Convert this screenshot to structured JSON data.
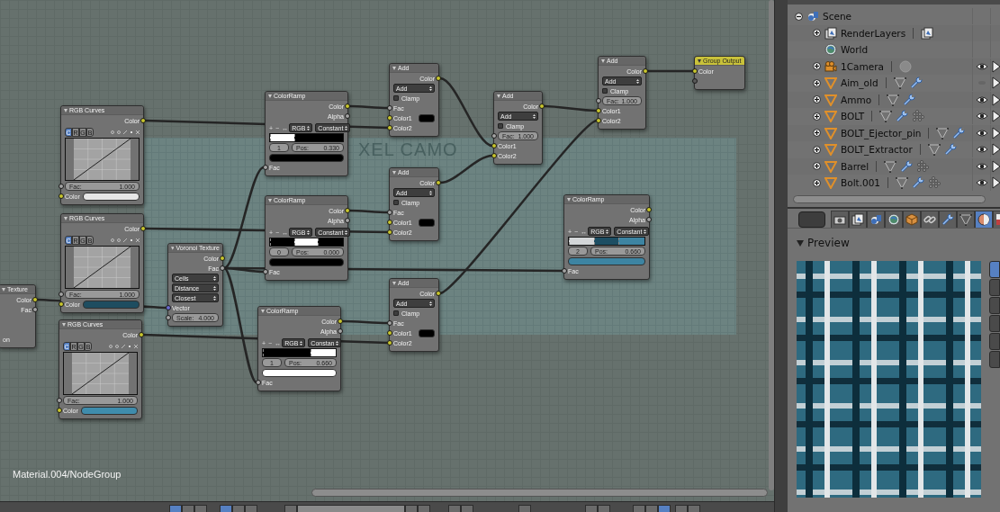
{
  "node_editor": {
    "frame": {
      "label": "XEL CAMO"
    },
    "nodes": [
      {
        "kind": "rgb_curves",
        "title": "RGB Curves",
        "rows": [
          {
            "kind": "output",
            "label": "Color",
            "socket": {
              "kind": "color"
            }
          },
          {
            "kind": "curve_tabs",
            "channels": [
              {
                "label": "C",
                "selected": true
              },
              {
                "label": "R",
                "selected": false
              },
              {
                "label": "G",
                "selected": false
              },
              {
                "label": "B",
                "selected": false
              }
            ]
          },
          {
            "kind": "curve"
          },
          {
            "kind": "field",
            "label": "Fac:",
            "value": "1.000",
            "socket": {
              "kind": "float"
            }
          },
          {
            "kind": "color_input",
            "label": "Color",
            "socket": {
              "kind": "color"
            },
            "color": "#e6e6e6"
          }
        ]
      },
      {
        "kind": "rgb_curves",
        "title": "RGB Curves",
        "rows": [
          {
            "kind": "output",
            "label": "Color",
            "socket": {
              "kind": "color"
            }
          },
          {
            "kind": "curve_tabs",
            "channels": [
              {
                "label": "C",
                "selected": true
              },
              {
                "label": "R",
                "selected": false
              },
              {
                "label": "G",
                "selected": false
              },
              {
                "label": "B",
                "selected": false
              }
            ]
          },
          {
            "kind": "curve"
          },
          {
            "kind": "field",
            "label": "Fac:",
            "value": "1.000",
            "socket": {
              "kind": "float"
            }
          },
          {
            "kind": "color_input",
            "label": "Color",
            "socket": {
              "kind": "color"
            },
            "color": "#1e4d60"
          }
        ]
      },
      {
        "kind": "rgb_curves",
        "title": "RGB Curves",
        "rows": [
          {
            "kind": "output",
            "label": "Color",
            "socket": {
              "kind": "color"
            }
          },
          {
            "kind": "curve_tabs",
            "channels": [
              {
                "label": "C",
                "selected": true
              },
              {
                "label": "R",
                "selected": false
              },
              {
                "label": "G",
                "selected": false
              },
              {
                "label": "B",
                "selected": false
              }
            ]
          },
          {
            "kind": "curve"
          },
          {
            "kind": "field",
            "label": "Fac:",
            "value": "1.000",
            "socket": {
              "kind": "float"
            }
          },
          {
            "kind": "color_input",
            "label": "Color",
            "socket": {
              "kind": "color"
            },
            "color": "#3f8cac"
          }
        ]
      },
      {
        "kind": "texture",
        "title": "Texture",
        "rows": [
          {
            "kind": "output",
            "label": "Color",
            "socket": {
              "kind": "color"
            }
          },
          {
            "kind": "output",
            "label": "Fac",
            "socket": {
              "kind": "float"
            }
          },
          {
            "kind": "spacer"
          },
          {
            "kind": "spacer"
          },
          {
            "kind": "input",
            "label": "on"
          }
        ]
      },
      {
        "kind": "voronoi",
        "title": "Voronoi Texture",
        "rows": [
          {
            "kind": "output",
            "label": "Color",
            "socket": {
              "kind": "color"
            }
          },
          {
            "kind": "output",
            "label": "Fac",
            "socket": {
              "kind": "float"
            }
          },
          {
            "kind": "dropdown",
            "value": "Cells"
          },
          {
            "kind": "dropdown",
            "value": "Distance"
          },
          {
            "kind": "dropdown",
            "value": "Closest"
          },
          {
            "kind": "input",
            "label": "Vector",
            "socket": {
              "kind": "vector"
            }
          },
          {
            "kind": "field",
            "label": "Scale:",
            "value": "4.000",
            "socket": {
              "kind": "float"
            }
          }
        ]
      },
      {
        "kind": "color_ramp",
        "title": "ColorRamp",
        "rows": [
          {
            "kind": "output",
            "label": "Color",
            "socket": {
              "kind": "color"
            }
          },
          {
            "kind": "output",
            "label": "Alpha",
            "socket": {
              "kind": "float"
            }
          },
          {
            "kind": "ramp_toolbar",
            "tools": [
              "+",
              "−",
              "↔"
            ],
            "mode": "RGB",
            "interp": "Constant"
          },
          {
            "kind": "ramp",
            "stops": [
              {
                "color": "#ffffff",
                "level": 0
              },
              {
                "color": "#000000",
                "level": 0.33
              }
            ]
          },
          {
            "kind": "ramp_stop",
            "index": "1",
            "label": "Pos:",
            "value": "0.330"
          },
          {
            "kind": "swatch",
            "color": "#000000"
          },
          {
            "kind": "input",
            "label": "Fac",
            "socket": {
              "kind": "float"
            }
          }
        ]
      },
      {
        "kind": "color_ramp",
        "title": "ColorRamp",
        "rows": [
          {
            "kind": "output",
            "label": "Color",
            "socket": {
              "kind": "color"
            }
          },
          {
            "kind": "output",
            "label": "Alpha",
            "socket": {
              "kind": "float"
            }
          },
          {
            "kind": "ramp_toolbar",
            "tools": [
              "+",
              "−",
              "↔"
            ],
            "mode": "RGB",
            "interp": "Constant"
          },
          {
            "kind": "ramp",
            "stops": [
              {
                "color": "#000000",
                "level": 0
              },
              {
                "color": "#ffffff",
                "level": 0.33
              },
              {
                "color": "#000000",
                "level": 0.65
              }
            ]
          },
          {
            "kind": "ramp_stop",
            "index": "0",
            "label": "Pos:",
            "value": "0.000"
          },
          {
            "kind": "swatch",
            "color": "#000000"
          },
          {
            "kind": "input",
            "label": "Fac",
            "socket": {
              "kind": "float"
            }
          }
        ]
      },
      {
        "kind": "color_ramp",
        "title": "ColorRamp",
        "rows": [
          {
            "kind": "output",
            "label": "Color",
            "socket": {
              "kind": "color"
            }
          },
          {
            "kind": "output",
            "label": "Alpha",
            "socket": {
              "kind": "float"
            }
          },
          {
            "kind": "ramp_toolbar",
            "tools": [
              "+",
              "−",
              "↔"
            ],
            "mode": "RGB",
            "interp": "Constan"
          },
          {
            "kind": "ramp",
            "stops": [
              {
                "color": "#000000",
                "level": 0
              },
              {
                "color": "#ffffff",
                "level": 0.66
              }
            ]
          },
          {
            "kind": "ramp_stop",
            "index": "1",
            "label": "Pos:",
            "value": "0.660"
          },
          {
            "kind": "swatch",
            "color": "#ffffff"
          },
          {
            "kind": "input",
            "label": "Fac",
            "socket": {
              "kind": "float"
            }
          }
        ]
      },
      {
        "kind": "mix",
        "title": "Add",
        "rows": [
          {
            "kind": "output",
            "label": "Color",
            "socket": {
              "kind": "color"
            }
          },
          {
            "kind": "dropdown",
            "value": "Add"
          },
          {
            "kind": "checkbox",
            "label": "Clamp",
            "checked": false
          },
          {
            "kind": "input",
            "label": "Fac",
            "socket": {
              "kind": "float"
            }
          },
          {
            "kind": "color_input",
            "label": "Color1",
            "socket": {
              "kind": "color"
            },
            "color": "#000000"
          },
          {
            "kind": "input",
            "label": "Color2",
            "socket": {
              "kind": "color"
            }
          }
        ]
      },
      {
        "kind": "mix",
        "title": "Add",
        "rows": [
          {
            "kind": "output",
            "label": "Color",
            "socket": {
              "kind": "color"
            }
          },
          {
            "kind": "dropdown",
            "value": "Add"
          },
          {
            "kind": "checkbox",
            "label": "Clamp",
            "checked": false
          },
          {
            "kind": "input",
            "label": "Fac",
            "socket": {
              "kind": "float"
            }
          },
          {
            "kind": "color_input",
            "label": "Color1",
            "socket": {
              "kind": "color"
            },
            "color": "#000000"
          },
          {
            "kind": "input",
            "label": "Color2",
            "socket": {
              "kind": "color"
            }
          }
        ]
      },
      {
        "kind": "mix",
        "title": "Add",
        "rows": [
          {
            "kind": "output",
            "label": "Color",
            "socket": {
              "kind": "color"
            }
          },
          {
            "kind": "dropdown",
            "value": "Add"
          },
          {
            "kind": "checkbox",
            "label": "Clamp",
            "checked": false
          },
          {
            "kind": "input",
            "label": "Fac",
            "socket": {
              "kind": "float"
            }
          },
          {
            "kind": "color_input",
            "label": "Color1",
            "socket": {
              "kind": "color"
            },
            "color": "#000000"
          },
          {
            "kind": "input",
            "label": "Color2",
            "socket": {
              "kind": "color"
            }
          }
        ]
      },
      {
        "kind": "mix",
        "title": "Add",
        "rows": [
          {
            "kind": "output",
            "label": "Color",
            "socket": {
              "kind": "color"
            }
          },
          {
            "kind": "dropdown",
            "value": "Add"
          },
          {
            "kind": "checkbox",
            "label": "Clamp",
            "checked": false
          },
          {
            "kind": "field",
            "label": "Fac:",
            "value": "1.000",
            "socket": {
              "kind": "float"
            }
          },
          {
            "kind": "input",
            "label": "Color1",
            "socket": {
              "kind": "color"
            }
          },
          {
            "kind": "input",
            "label": "Color2",
            "socket": {
              "kind": "color"
            }
          }
        ]
      },
      {
        "kind": "mix",
        "title": "Add",
        "rows": [
          {
            "kind": "output",
            "label": "Color",
            "socket": {
              "kind": "color"
            }
          },
          {
            "kind": "dropdown",
            "value": "Add"
          },
          {
            "kind": "checkbox",
            "label": "Clamp",
            "checked": false
          },
          {
            "kind": "field",
            "label": "Fac:",
            "value": "1.000",
            "socket": {
              "kind": "float"
            }
          },
          {
            "kind": "input",
            "label": "Color1",
            "socket": {
              "kind": "color"
            }
          },
          {
            "kind": "input",
            "label": "Color2",
            "socket": {
              "kind": "color"
            }
          }
        ]
      },
      {
        "kind": "group_output",
        "title": "Group Output",
        "rows": [
          {
            "kind": "input",
            "label": "Color",
            "socket": {
              "kind": "color"
            }
          },
          {
            "kind": "input",
            "socket": {
              "kind": "empty"
            }
          }
        ]
      },
      {
        "kind": "color_ramp",
        "title": "ColorRamp",
        "rows": [
          {
            "kind": "output",
            "label": "Color",
            "socket": {
              "kind": "color"
            }
          },
          {
            "kind": "output",
            "label": "Alpha",
            "socket": {
              "kind": "float"
            }
          },
          {
            "kind": "ramp_toolbar",
            "tools": [
              "+",
              "−",
              "↔"
            ],
            "mode": "RGB",
            "interp": "Constant"
          },
          {
            "kind": "ramp",
            "stops": [
              {
                "color": "#d3d6d8",
                "level": 0
              },
              {
                "color": "#1d4e63",
                "level": 0.33
              },
              {
                "color": "#3d84a2",
                "level": 0.66
              }
            ]
          },
          {
            "kind": "ramp_stop",
            "index": "2",
            "label": "Pos:",
            "value": "0.660"
          },
          {
            "kind": "swatch",
            "color": "#3d84a2"
          },
          {
            "kind": "input",
            "label": "Fac",
            "socket": {
              "kind": "float"
            }
          }
        ]
      }
    ],
    "path": "Material.004/NodeGroup"
  },
  "header": {
    "groups": [
      {
        "items": [
          {
            "kind": "button",
            "selected": true
          },
          {
            "kind": "button",
            "selected": false
          },
          {
            "kind": "button",
            "selected": false
          }
        ]
      },
      {
        "items": [
          {
            "kind": "button",
            "selected": true
          },
          {
            "kind": "button",
            "selected": false
          },
          {
            "kind": "button",
            "selected": false
          }
        ]
      },
      {
        "items": [
          {
            "kind": "button",
            "selected": false
          },
          {
            "kind": "field"
          },
          {
            "kind": "button",
            "selected": false
          },
          {
            "kind": "button",
            "selected": false
          }
        ]
      },
      {
        "items": [
          {
            "kind": "button",
            "selected": false
          },
          {
            "kind": "button",
            "selected": false
          }
        ]
      },
      {
        "items": [
          {
            "kind": "button",
            "selected": false
          }
        ]
      },
      {
        "items": [
          {
            "kind": "button",
            "selected": false
          },
          {
            "kind": "button",
            "selected": false
          }
        ]
      },
      {
        "items": [
          {
            "kind": "button",
            "selected": false
          },
          {
            "kind": "button",
            "selected": false
          },
          {
            "kind": "button",
            "selected": true
          }
        ]
      },
      {
        "items": [
          {
            "kind": "button",
            "selected": false
          },
          {
            "kind": "button",
            "selected": false
          }
        ]
      }
    ]
  },
  "outliner": {
    "items": [
      {
        "label": "Scene",
        "kind": "scene",
        "expanded": true,
        "children": [
          {
            "label": "RenderLayers",
            "kind": "render_layers",
            "expanded": false,
            "extras": [
              {
                "kind": "render_layers"
              }
            ]
          },
          {
            "label": "World",
            "kind": "world"
          },
          {
            "label": "1Camera",
            "kind": "camera",
            "expanded": false,
            "visible": true,
            "extras": [
              {
                "kind": "camera_data"
              }
            ]
          },
          {
            "label": "Aim_old",
            "kind": "mesh",
            "expanded": false,
            "visible": false,
            "extras": [
              {
                "kind": "mesh_data"
              },
              {
                "kind": "modifier"
              }
            ]
          },
          {
            "label": "Ammo",
            "kind": "mesh",
            "expanded": false,
            "visible": true,
            "extras": [
              {
                "kind": "mesh_data"
              },
              {
                "kind": "modifier"
              }
            ]
          },
          {
            "label": "BOLT",
            "kind": "mesh",
            "expanded": false,
            "visible": true,
            "extras": [
              {
                "kind": "mesh_data"
              },
              {
                "kind": "modifier"
              },
              {
                "kind": "particles"
              }
            ]
          },
          {
            "label": "BOLT_Ejector_pin",
            "kind": "mesh",
            "expanded": false,
            "visible": true,
            "extras": [
              {
                "kind": "mesh_data"
              },
              {
                "kind": "modifier"
              }
            ]
          },
          {
            "label": "BOLT_Extractor",
            "kind": "mesh",
            "expanded": false,
            "visible": true,
            "extras": [
              {
                "kind": "mesh_data"
              },
              {
                "kind": "modifier"
              }
            ]
          },
          {
            "label": "Barrel",
            "kind": "mesh",
            "expanded": false,
            "visible": true,
            "extras": [
              {
                "kind": "mesh_data"
              },
              {
                "kind": "modifier"
              },
              {
                "kind": "particles"
              }
            ]
          },
          {
            "label": "Bolt.001",
            "kind": "mesh",
            "expanded": false,
            "visible": true,
            "extras": [
              {
                "kind": "mesh_data"
              },
              {
                "kind": "modifier"
              },
              {
                "kind": "particles"
              }
            ]
          }
        ]
      }
    ]
  },
  "properties": {
    "tabs": [
      {
        "kind": "render",
        "selected": false
      },
      {
        "kind": "render_layers",
        "selected": false
      },
      {
        "kind": "scene",
        "selected": false
      },
      {
        "kind": "world",
        "selected": false
      },
      {
        "kind": "object",
        "selected": false
      },
      {
        "kind": "constraints",
        "selected": false
      },
      {
        "kind": "modifiers",
        "selected": false
      },
      {
        "kind": "data",
        "selected": false
      },
      {
        "kind": "material",
        "selected": true
      },
      {
        "kind": "texture",
        "selected": false
      }
    ],
    "panel": {
      "title": "Preview",
      "expanded": true,
      "preview_buttons": [
        {
          "selected": true
        },
        {
          "selected": false
        },
        {
          "selected": false
        },
        {
          "selected": false
        },
        {
          "selected": false
        },
        {
          "selected": false
        }
      ]
    }
  }
}
